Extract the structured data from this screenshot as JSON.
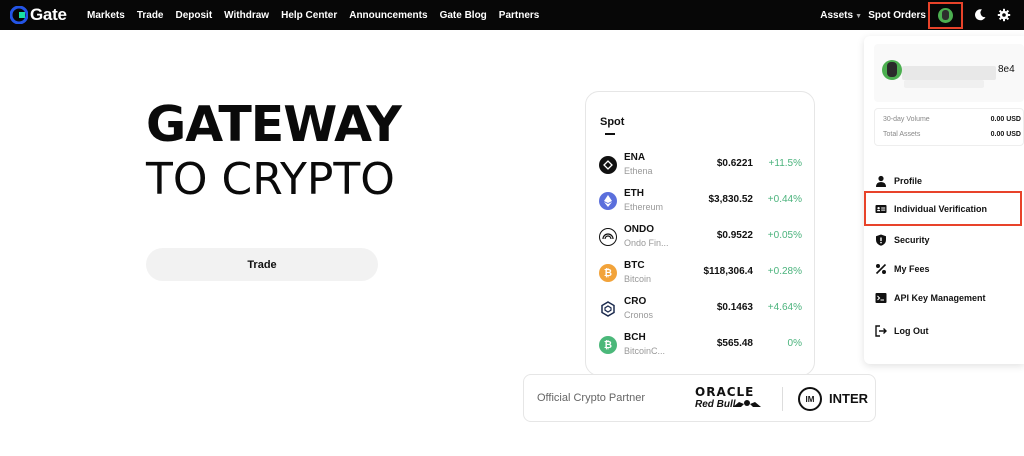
{
  "nav": {
    "logo_text": "Gate",
    "links": [
      "Markets",
      "Trade",
      "Deposit",
      "Withdraw",
      "Help Center",
      "Announcements",
      "Gate Blog",
      "Partners"
    ],
    "assets": "Assets",
    "spot_orders": "Spot Orders"
  },
  "hero": {
    "line1": "GATEWAY",
    "line2_prefix": "TO ",
    "line2_highlight": "CRYPTO",
    "trade_button": "Trade",
    "highlight_color": "#b6f26a"
  },
  "spot": {
    "title": "Spot",
    "rows": [
      {
        "symbol": "ENA",
        "name": "Ethena",
        "price": "$0.6221",
        "change": "+11.5%",
        "icon_color": "#111111"
      },
      {
        "symbol": "ETH",
        "name": "Ethereum",
        "price": "$3,830.52",
        "change": "+0.44%",
        "icon_color": "#5b6fdc"
      },
      {
        "symbol": "ONDO",
        "name": "Ondo Fin...",
        "price": "$0.9522",
        "change": "+0.05%",
        "icon_color": "#111111"
      },
      {
        "symbol": "BTC",
        "name": "Bitcoin",
        "price": "$118,306.4",
        "change": "+0.28%",
        "icon_color": "#f2a33a"
      },
      {
        "symbol": "CRO",
        "name": "Cronos",
        "price": "$0.1463",
        "change": "+4.64%",
        "icon_color": "#1b2a4e"
      },
      {
        "symbol": "BCH",
        "name": "BitcoinC...",
        "price": "$565.48",
        "change": "0%",
        "icon_color": "#4bb87a"
      }
    ]
  },
  "partner": {
    "label": "Official Crypto Partner",
    "oracle": "ORACLE",
    "redbull": "Red Bull",
    "inter": "INTER"
  },
  "dropdown": {
    "user_id_suffix": "8e4",
    "volume_label": "30-day Volume",
    "volume_value": "0.00 USD",
    "assets_label": "Total Assets",
    "assets_value": "0.00 USD",
    "menu": [
      "Profile",
      "Individual Verification",
      "Security",
      "My Fees",
      "API Key Management",
      "Log Out"
    ]
  },
  "colors": {
    "positive": "#4ab37c",
    "highlight_box": "#e8432a",
    "nav_bg": "#070707"
  }
}
